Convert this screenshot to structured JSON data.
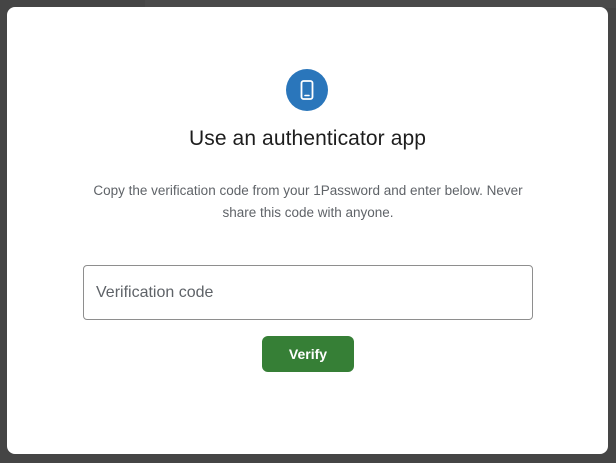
{
  "dialog": {
    "icon": "smartphone-icon",
    "title": "Use an authenticator app",
    "description": "Copy the verification code from your 1Password and enter below. Never share this code with anyone.",
    "code_field": {
      "placeholder": "Verification code",
      "value": ""
    },
    "verify_label": "Verify"
  },
  "colors": {
    "icon_circle": "#2a76bb",
    "verify_button": "#367f36",
    "backdrop": "#454545"
  }
}
